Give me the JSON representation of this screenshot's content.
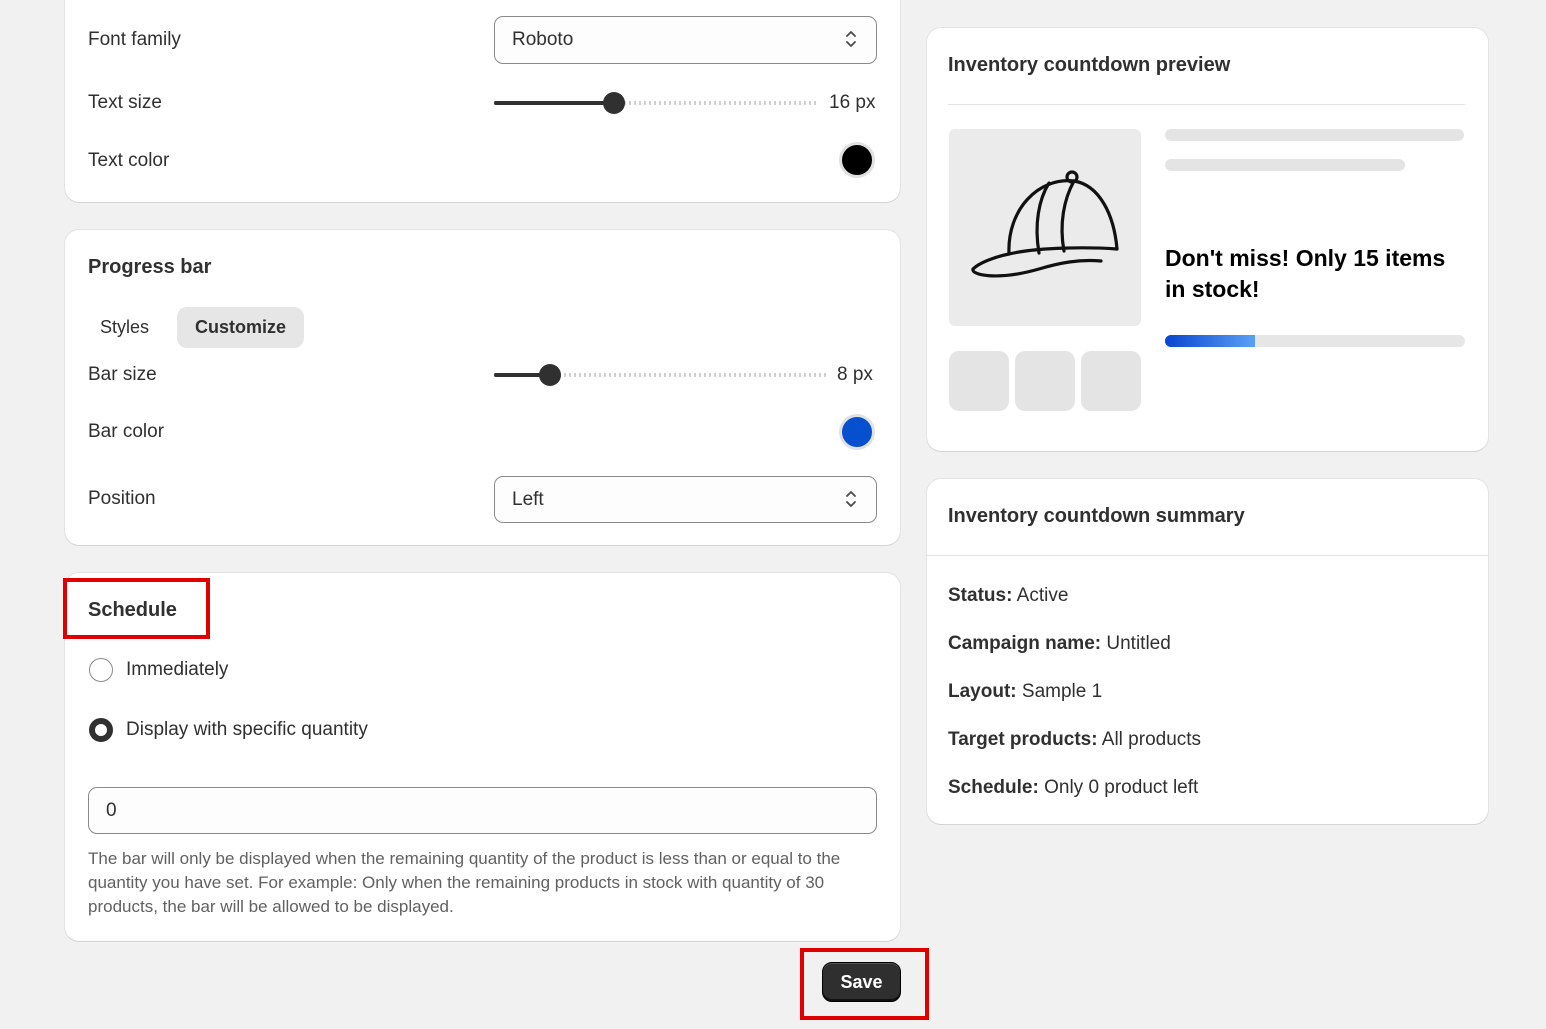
{
  "typography": {
    "font_family_label": "Font family",
    "font_family_value": "Roboto",
    "text_size_label": "Text size",
    "text_size_value": "16 px",
    "text_size_fraction": 0.37,
    "text_color_label": "Text color",
    "text_color": "#000000"
  },
  "progress_bar": {
    "title": "Progress bar",
    "tabs": [
      {
        "label": "Styles"
      },
      {
        "label": "Customize"
      }
    ],
    "active_tab": "Customize",
    "bar_size_label": "Bar size",
    "bar_size_value": "8 px",
    "bar_size_fraction": 0.17,
    "bar_color_label": "Bar color",
    "bar_color": "#0650d0",
    "position_label": "Position",
    "position_value": "Left"
  },
  "schedule": {
    "title": "Schedule",
    "options": [
      {
        "label": "Immediately",
        "checked": false
      },
      {
        "label": "Display with specific quantity",
        "checked": true
      }
    ],
    "quantity_value": "0",
    "help_text": "The bar will only be displayed when the remaining quantity of the product is less than or equal to the quantity you have set. For example: Only when the remaining products in stock with quantity of 30 products, the bar will be allowed to be displayed."
  },
  "save_label": "Save",
  "preview": {
    "title": "Inventory countdown preview",
    "message": "Don't miss! Only 15 items in stock!",
    "progress_fraction": 0.3,
    "product_icon": "cap-icon"
  },
  "summary": {
    "title": "Inventory countdown summary",
    "rows": [
      {
        "key": "Status:",
        "value": "Active"
      },
      {
        "key": "Campaign name:",
        "value": "Untitled"
      },
      {
        "key": "Layout:",
        "value": "Sample 1"
      },
      {
        "key": "Target products:",
        "value": "All products"
      },
      {
        "key": "Schedule:",
        "value": "Only 0 product left"
      }
    ]
  }
}
